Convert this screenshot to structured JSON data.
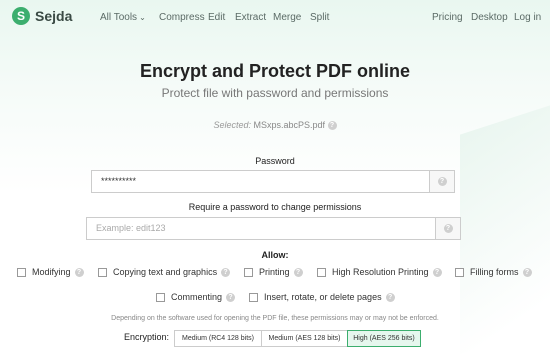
{
  "brand": {
    "name": "Sejda",
    "logo_letter": "S",
    "color": "#3cae6e"
  },
  "nav": {
    "all_tools": "All Tools",
    "compress": "Compress",
    "edit": "Edit",
    "extract": "Extract",
    "merge": "Merge",
    "split": "Split",
    "pricing": "Pricing",
    "desktop": "Desktop",
    "login": "Log in"
  },
  "page": {
    "title": "Encrypt and Protect PDF online",
    "subtitle": "Protect file with password and permissions",
    "selected_label": "Selected:",
    "selected_file": "MSxps.abcPS.pdf"
  },
  "password": {
    "label": "Password",
    "value": "**********"
  },
  "permissions_password": {
    "label": "Require a password to change permissions",
    "placeholder": "Example: edit123"
  },
  "allow": {
    "label": "Allow:",
    "options": [
      "Modifying",
      "Copying text and graphics",
      "Printing",
      "High Resolution Printing",
      "Filling forms",
      "Commenting",
      "Insert, rotate, or delete pages"
    ]
  },
  "note": "Depending on the software used for opening the PDF file, these permissions may or may not be enforced.",
  "encryption": {
    "label": "Encryption:",
    "options": [
      "Medium (RC4 128 bits)",
      "Medium (AES 128 bits)",
      "High (AES 256 bits)"
    ],
    "selected": "High (AES 256 bits)"
  },
  "icons": {
    "help": "help-icon",
    "chevron": "chevron-down-icon"
  }
}
